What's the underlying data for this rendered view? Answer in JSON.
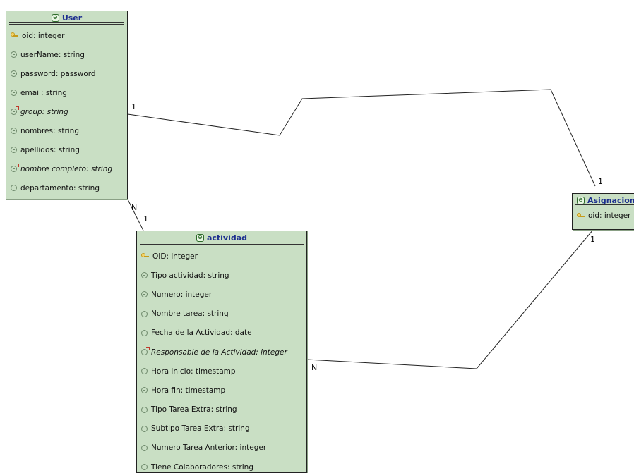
{
  "diagram": {
    "entities": {
      "user": {
        "title": "User",
        "attributes": [
          {
            "text": "oid: integer",
            "kind": "key"
          },
          {
            "text": "userName: string",
            "kind": "attr"
          },
          {
            "text": "password: password",
            "kind": "attr"
          },
          {
            "text": "email: string",
            "kind": "attr"
          },
          {
            "text": "group: string",
            "kind": "derived"
          },
          {
            "text": "nombres: string",
            "kind": "attr"
          },
          {
            "text": "apellidos: string",
            "kind": "attr"
          },
          {
            "text": "nombre completo: string",
            "kind": "derived"
          },
          {
            "text": "departamento: string",
            "kind": "attr"
          }
        ]
      },
      "actividad": {
        "title": "actividad",
        "attributes": [
          {
            "text": "OID: integer",
            "kind": "key"
          },
          {
            "text": "Tipo actividad: string",
            "kind": "attr"
          },
          {
            "text": "Numero: integer",
            "kind": "attr"
          },
          {
            "text": "Nombre tarea: string",
            "kind": "attr"
          },
          {
            "text": "Fecha de la Actividad: date",
            "kind": "attr"
          },
          {
            "text": "Responsable de la Actividad: integer",
            "kind": "derived"
          },
          {
            "text": "Hora inicio: timestamp",
            "kind": "attr"
          },
          {
            "text": "Hora fin: timestamp",
            "kind": "attr"
          },
          {
            "text": "Tipo Tarea Extra: string",
            "kind": "attr"
          },
          {
            "text": "Subtipo Tarea Extra: string",
            "kind": "attr"
          },
          {
            "text": "Numero Tarea Anterior: integer",
            "kind": "attr"
          },
          {
            "text": "Tiene Colaboradores: string",
            "kind": "attr"
          }
        ]
      },
      "asignacion": {
        "title": "Asignacion",
        "attributes": [
          {
            "text": "oid: integer",
            "kind": "key"
          }
        ]
      }
    },
    "multiplicities": {
      "user_asignacion_user_end": "1",
      "user_asignacion_asig_end": "1",
      "user_actividad_user_end": "N",
      "user_actividad_act_end": "1",
      "actividad_asignacion_act_end": "N",
      "actividad_asignacion_asig_end": "1"
    },
    "colors": {
      "entity_fill": "#c9dfc4",
      "title_text": "#1d2f8f",
      "line": "#222222"
    }
  }
}
